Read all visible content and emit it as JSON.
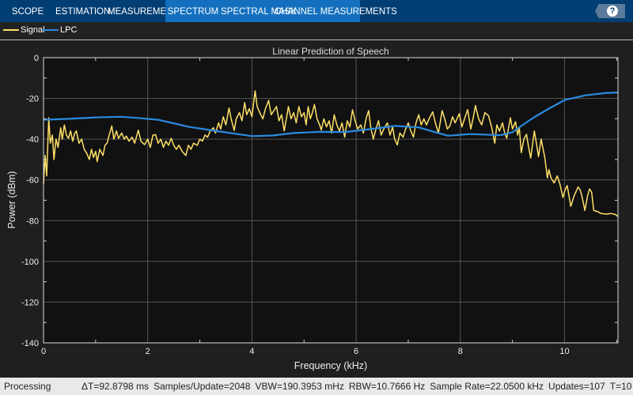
{
  "toolbar": {
    "tabs": [
      {
        "label": "SCOPE"
      },
      {
        "label": "ESTIMATION"
      },
      {
        "label": "MEASUREMENTS"
      },
      {
        "label": "SPECTRUM",
        "active": true
      },
      {
        "label": "SPECTRAL MASK"
      },
      {
        "label": "CHANNEL MEASUREMENTS"
      }
    ],
    "help_label": "?",
    "colors": {
      "bar": "#003e73",
      "active_tab": "#1470be"
    }
  },
  "legend": [
    {
      "label": "Signal",
      "color": "#ffe066"
    },
    {
      "label": "LPC",
      "color": "#2a8ae0"
    }
  ],
  "status": {
    "state": "Processing",
    "items": [
      "ΔT=92.8798 ms",
      "Samples/Update=2048",
      "VBW=190.3953 mHz",
      "RBW=10.7666 Hz",
      "Sample Rate=22.0500 kHz",
      "Updates=107",
      "T=10"
    ]
  },
  "chart_data": {
    "type": "line",
    "title": "Linear Prediction of Speech",
    "xlabel": "Frequency (kHz)",
    "ylabel": "Power (dBm)",
    "xlim": [
      0,
      11.025
    ],
    "ylim": [
      -140,
      0
    ],
    "xticks": [
      "0",
      "2",
      "4",
      "6",
      "8",
      "10"
    ],
    "yticks": [
      "0",
      "-20",
      "-40",
      "-60",
      "-80",
      "-100",
      "-120",
      "-140"
    ],
    "grid": true,
    "background": "#111111",
    "series": [
      {
        "name": "Signal",
        "color": "#ffe066",
        "points": [
          [
            0,
            -62
          ],
          [
            0.03,
            -48
          ],
          [
            0.06,
            -58
          ],
          [
            0.1,
            -29.5
          ],
          [
            0.13,
            -42
          ],
          [
            0.17,
            -38
          ],
          [
            0.2,
            -50
          ],
          [
            0.24,
            -40
          ],
          [
            0.28,
            -44
          ],
          [
            0.33,
            -34.4
          ],
          [
            0.36,
            -40
          ],
          [
            0.4,
            -33
          ],
          [
            0.44,
            -38
          ],
          [
            0.48,
            -39.6
          ],
          [
            0.52,
            -36
          ],
          [
            0.56,
            -41
          ],
          [
            0.6,
            -37
          ],
          [
            0.63,
            -36
          ],
          [
            0.68,
            -42
          ],
          [
            0.73,
            -40
          ],
          [
            0.78,
            -45
          ],
          [
            0.83,
            -47
          ],
          [
            0.88,
            -50
          ],
          [
            0.92,
            -45
          ],
          [
            0.96,
            -49
          ],
          [
            1.0,
            -46
          ],
          [
            1.03,
            -51
          ],
          [
            1.08,
            -45
          ],
          [
            1.14,
            -48
          ],
          [
            1.18,
            -43
          ],
          [
            1.22,
            -42
          ],
          [
            1.26,
            -38
          ],
          [
            1.31,
            -33.5
          ],
          [
            1.35,
            -40
          ],
          [
            1.4,
            -36
          ],
          [
            1.44,
            -39.6
          ],
          [
            1.5,
            -37
          ],
          [
            1.55,
            -40
          ],
          [
            1.59,
            -38.5
          ],
          [
            1.64,
            -41
          ],
          [
            1.7,
            -39
          ],
          [
            1.75,
            -42
          ],
          [
            1.82,
            -35.6
          ],
          [
            1.87,
            -41
          ],
          [
            1.94,
            -42.7
          ],
          [
            2.0,
            -40
          ],
          [
            2.05,
            -44
          ],
          [
            2.1,
            -38
          ],
          [
            2.15,
            -37.8
          ],
          [
            2.2,
            -42
          ],
          [
            2.25,
            -40
          ],
          [
            2.3,
            -44
          ],
          [
            2.35,
            -41
          ],
          [
            2.4,
            -43
          ],
          [
            2.45,
            -39.6
          ],
          [
            2.5,
            -43
          ],
          [
            2.55,
            -45
          ],
          [
            2.6,
            -43
          ],
          [
            2.66,
            -46
          ],
          [
            2.73,
            -48
          ],
          [
            2.78,
            -43
          ],
          [
            2.83,
            -45
          ],
          [
            2.88,
            -42
          ],
          [
            2.95,
            -43
          ],
          [
            3.0,
            -40
          ],
          [
            3.05,
            -41
          ],
          [
            3.1,
            -38
          ],
          [
            3.15,
            -39
          ],
          [
            3.2,
            -36
          ],
          [
            3.26,
            -34.4
          ],
          [
            3.3,
            -37
          ],
          [
            3.36,
            -32
          ],
          [
            3.4,
            -35
          ],
          [
            3.45,
            -29
          ],
          [
            3.5,
            -33
          ],
          [
            3.56,
            -24.7
          ],
          [
            3.6,
            -30
          ],
          [
            3.66,
            -35.7
          ],
          [
            3.7,
            -30
          ],
          [
            3.76,
            -27
          ],
          [
            3.81,
            -31
          ],
          [
            3.86,
            -22
          ],
          [
            3.9,
            -28
          ],
          [
            3.95,
            -25
          ],
          [
            4.0,
            -29
          ],
          [
            4.06,
            -16.3
          ],
          [
            4.1,
            -24
          ],
          [
            4.15,
            -27
          ],
          [
            4.21,
            -30
          ],
          [
            4.26,
            -25
          ],
          [
            4.32,
            -21
          ],
          [
            4.37,
            -28
          ],
          [
            4.42,
            -26
          ],
          [
            4.47,
            -24
          ],
          [
            4.52,
            -31
          ],
          [
            4.57,
            -28
          ],
          [
            4.62,
            -36
          ],
          [
            4.66,
            -30
          ],
          [
            4.7,
            -24
          ],
          [
            4.75,
            -30
          ],
          [
            4.8,
            -27
          ],
          [
            4.85,
            -32
          ],
          [
            4.9,
            -24
          ],
          [
            4.95,
            -29
          ],
          [
            5.0,
            -27
          ],
          [
            5.04,
            -33
          ],
          [
            5.08,
            -24
          ],
          [
            5.12,
            -30
          ],
          [
            5.16,
            -27
          ],
          [
            5.2,
            -23
          ],
          [
            5.25,
            -30
          ],
          [
            5.3,
            -33
          ],
          [
            5.33,
            -35.5
          ],
          [
            5.38,
            -30
          ],
          [
            5.43,
            -34
          ],
          [
            5.48,
            -31
          ],
          [
            5.53,
            -37
          ],
          [
            5.58,
            -28
          ],
          [
            5.63,
            -33
          ],
          [
            5.68,
            -36
          ],
          [
            5.73,
            -32
          ],
          [
            5.78,
            -39
          ],
          [
            5.83,
            -31
          ],
          [
            5.88,
            -34
          ],
          [
            5.93,
            -25.6
          ],
          [
            5.98,
            -31
          ],
          [
            6.03,
            -35
          ],
          [
            6.09,
            -33
          ],
          [
            6.14,
            -37
          ],
          [
            6.19,
            -30
          ],
          [
            6.24,
            -26
          ],
          [
            6.28,
            -34
          ],
          [
            6.33,
            -40
          ],
          [
            6.38,
            -35
          ],
          [
            6.43,
            -31
          ],
          [
            6.48,
            -38
          ],
          [
            6.53,
            -35
          ],
          [
            6.6,
            -32
          ],
          [
            6.65,
            -38
          ],
          [
            6.7,
            -34
          ],
          [
            6.74,
            -40
          ],
          [
            6.79,
            -42.8
          ],
          [
            6.84,
            -37
          ],
          [
            6.9,
            -39
          ],
          [
            6.95,
            -35
          ],
          [
            7.0,
            -32
          ],
          [
            7.05,
            -36
          ],
          [
            7.1,
            -39
          ],
          [
            7.15,
            -32
          ],
          [
            7.2,
            -28
          ],
          [
            7.25,
            -33
          ],
          [
            7.3,
            -30
          ],
          [
            7.35,
            -33
          ],
          [
            7.4,
            -30
          ],
          [
            7.47,
            -26.6
          ],
          [
            7.52,
            -32
          ],
          [
            7.58,
            -37
          ],
          [
            7.65,
            -26
          ],
          [
            7.7,
            -30
          ],
          [
            7.75,
            -35
          ],
          [
            7.8,
            -33.5
          ],
          [
            7.85,
            -29
          ],
          [
            7.9,
            -32
          ],
          [
            7.98,
            -27.5
          ],
          [
            8.03,
            -34
          ],
          [
            8.08,
            -30
          ],
          [
            8.14,
            -25.5
          ],
          [
            8.2,
            -35
          ],
          [
            8.25,
            -29
          ],
          [
            8.29,
            -23.5
          ],
          [
            8.35,
            -30
          ],
          [
            8.41,
            -33
          ],
          [
            8.47,
            -27
          ],
          [
            8.54,
            -28.5
          ],
          [
            8.6,
            -34
          ],
          [
            8.66,
            -42
          ],
          [
            8.7,
            -33
          ],
          [
            8.75,
            -36
          ],
          [
            8.81,
            -32
          ],
          [
            8.85,
            -37
          ],
          [
            8.89,
            -39.5
          ],
          [
            8.96,
            -29.5
          ],
          [
            9.0,
            -35
          ],
          [
            9.06,
            -31.5
          ],
          [
            9.1,
            -38
          ],
          [
            9.13,
            -34
          ],
          [
            9.17,
            -46.6
          ],
          [
            9.22,
            -40
          ],
          [
            9.27,
            -37.6
          ],
          [
            9.31,
            -44
          ],
          [
            9.35,
            -49.3
          ],
          [
            9.42,
            -36
          ],
          [
            9.46,
            -42
          ],
          [
            9.5,
            -48.6
          ],
          [
            9.55,
            -40
          ],
          [
            9.62,
            -49
          ],
          [
            9.67,
            -59
          ],
          [
            9.7,
            -55
          ],
          [
            9.74,
            -59
          ],
          [
            9.8,
            -61.5
          ],
          [
            9.86,
            -58
          ],
          [
            9.91,
            -62
          ],
          [
            9.97,
            -68.6
          ],
          [
            10.01,
            -65
          ],
          [
            10.05,
            -62.8
          ],
          [
            10.12,
            -73
          ],
          [
            10.18,
            -68
          ],
          [
            10.26,
            -63.5
          ],
          [
            10.3,
            -65
          ],
          [
            10.33,
            -67.6
          ],
          [
            10.39,
            -75
          ],
          [
            10.44,
            -68
          ],
          [
            10.48,
            -64.4
          ],
          [
            10.52,
            -66
          ],
          [
            10.56,
            -75
          ],
          [
            10.64,
            -75.6
          ],
          [
            10.7,
            -76.5
          ],
          [
            10.8,
            -76.8
          ],
          [
            10.9,
            -76.5
          ],
          [
            10.98,
            -77
          ],
          [
            11.02,
            -78
          ]
        ]
      },
      {
        "name": "LPC",
        "color": "#2a8ae0",
        "points": [
          [
            0,
            -30.5
          ],
          [
            0.5,
            -30
          ],
          [
            1,
            -29.3
          ],
          [
            1.5,
            -29
          ],
          [
            1.8,
            -29.6
          ],
          [
            2.2,
            -30.5
          ],
          [
            2.8,
            -34
          ],
          [
            3.4,
            -36.3
          ],
          [
            4,
            -38.5
          ],
          [
            4.4,
            -38.2
          ],
          [
            4.8,
            -37
          ],
          [
            5.3,
            -36.4
          ],
          [
            5.8,
            -36.5
          ],
          [
            6.2,
            -35.3
          ],
          [
            6.75,
            -33.5
          ],
          [
            7.2,
            -34.2
          ],
          [
            7.5,
            -36.5
          ],
          [
            7.76,
            -38.3
          ],
          [
            8.2,
            -37.5
          ],
          [
            8.76,
            -38.1
          ],
          [
            9.0,
            -36.6
          ],
          [
            9.17,
            -33.5
          ],
          [
            9.4,
            -29.5
          ],
          [
            9.7,
            -25
          ],
          [
            10.0,
            -20.8
          ],
          [
            10.4,
            -18.5
          ],
          [
            10.8,
            -17.3
          ],
          [
            11.02,
            -17.1
          ]
        ]
      }
    ]
  }
}
